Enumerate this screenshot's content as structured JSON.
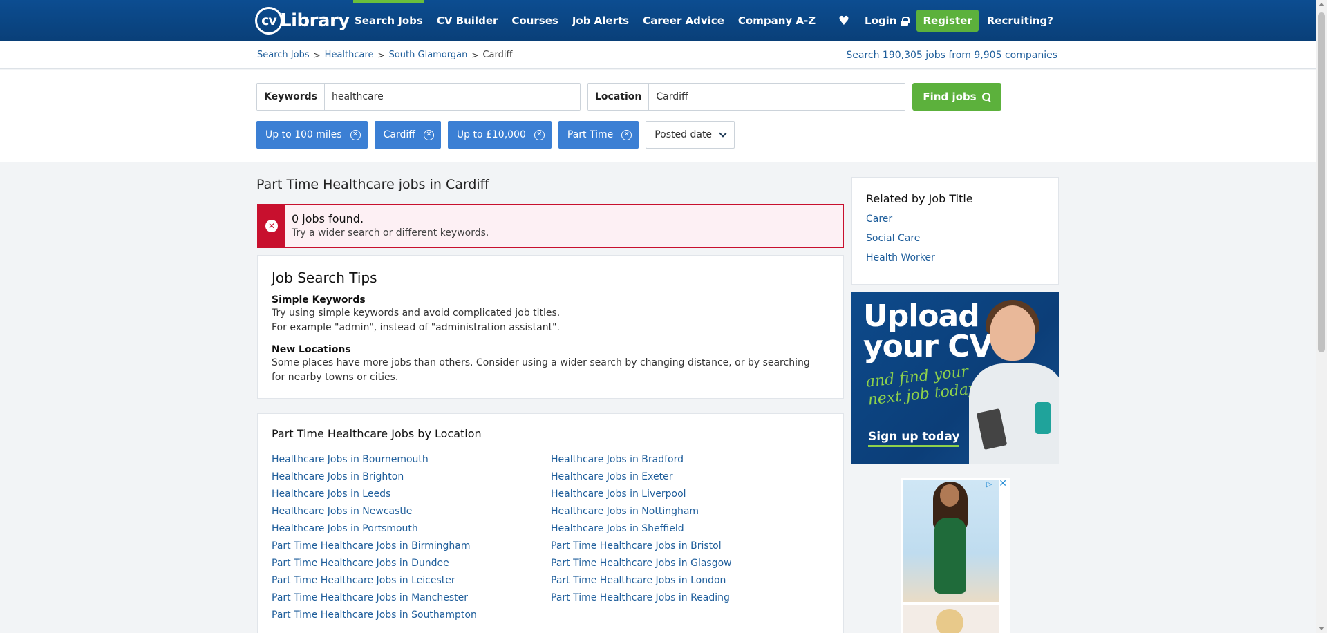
{
  "header": {
    "logo_cv": "cv",
    "logo_text": "Library",
    "nav": [
      "Search Jobs",
      "CV Builder",
      "Courses",
      "Job Alerts",
      "Career Advice",
      "Company A-Z"
    ],
    "login": "Login",
    "register": "Register",
    "recruiting": "Recruiting?"
  },
  "breadcrumb": {
    "items": [
      "Search Jobs",
      "Healthcare",
      "South Glamorgan"
    ],
    "current": "Cardiff",
    "separator": ">"
  },
  "jobcount": {
    "prefix": "Search",
    "jobs": "190,305",
    "mid": "jobs from",
    "companies": "9,905",
    "suffix": "companies"
  },
  "search": {
    "keywords_label": "Keywords",
    "keywords_value": "healthcare",
    "location_label": "Location",
    "location_value": "Cardiff",
    "find_button": "Find jobs"
  },
  "filters": {
    "chips": [
      "Up to 100 miles",
      "Cardiff",
      "Up to £10,000",
      "Part Time"
    ],
    "sort_label": "Posted date"
  },
  "main": {
    "title": "Part Time Healthcare jobs in Cardiff",
    "alert_title": "0 jobs found.",
    "alert_text": "Try a wider search or different keywords."
  },
  "tips": {
    "title": "Job Search Tips",
    "h1": "Simple Keywords",
    "p1a": "Try using simple keywords and avoid complicated job titles.",
    "p1b": "For example \"admin\", instead of \"administration assistant\".",
    "h2": "New Locations",
    "p2": "Some places have more jobs than others. Consider using a wider search by changing distance, or by searching for nearby towns or cities."
  },
  "bylocation": {
    "title": "Part Time Healthcare Jobs by Location",
    "links": [
      "Healthcare Jobs in Bournemouth",
      "Healthcare Jobs in Bradford",
      "Healthcare Jobs in Brighton",
      "Healthcare Jobs in Exeter",
      "Healthcare Jobs in Leeds",
      "Healthcare Jobs in Liverpool",
      "Healthcare Jobs in Newcastle",
      "Healthcare Jobs in Nottingham",
      "Healthcare Jobs in Portsmouth",
      "Healthcare Jobs in Sheffield",
      "Part Time Healthcare Jobs in Birmingham",
      "Part Time Healthcare Jobs in Bristol",
      "Part Time Healthcare Jobs in Dundee",
      "Part Time Healthcare Jobs in Glasgow",
      "Part Time Healthcare Jobs in Leicester",
      "Part Time Healthcare Jobs in London",
      "Part Time Healthcare Jobs in Manchester",
      "Part Time Healthcare Jobs in Reading",
      "Part Time Healthcare Jobs in Southampton"
    ]
  },
  "related": {
    "title": "Related by Job Title",
    "links": [
      "Carer",
      "Social Care",
      "Health Worker"
    ]
  },
  "ad": {
    "headline_1": "Upload",
    "headline_2": "your CV",
    "script_1": "and find your",
    "script_2": "next job today!",
    "cta": "Sign up today"
  },
  "colors": {
    "header": "#0c4d91",
    "accent_green": "#5cb13c",
    "chip_blue": "#3b7fd4",
    "link": "#1f5e9b",
    "error": "#c8102e"
  }
}
